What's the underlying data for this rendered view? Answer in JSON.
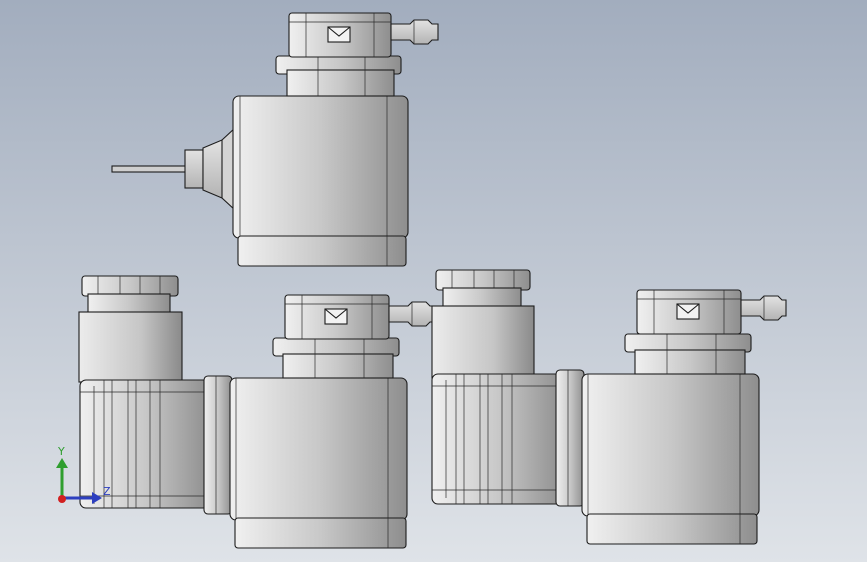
{
  "background": {
    "top": "#a2adbe",
    "bottom": "#dfe3e8"
  },
  "body_colors": {
    "light": "#e6e6e6",
    "mid": "#c6c6c6",
    "dark": "#8e8e8e",
    "edge": "#1c1c1c"
  },
  "triad": {
    "y_label": "Y",
    "z_label": "Z",
    "y_color": "#2f9e2f",
    "z_color": "#2d3fbf",
    "x_color": "#d22020"
  },
  "views": [
    "top-view",
    "front-view",
    "side-view"
  ],
  "icons": [
    "connector-envelope-icon"
  ]
}
